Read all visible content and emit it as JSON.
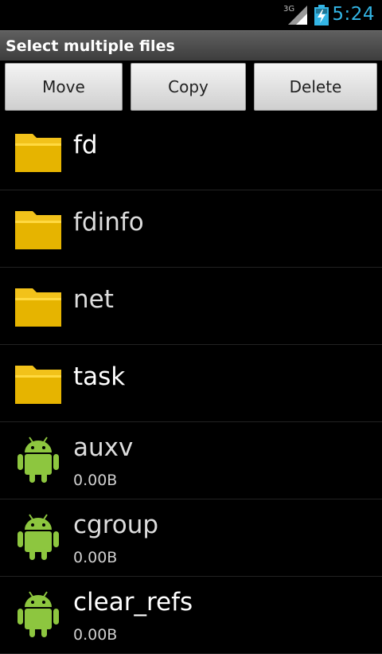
{
  "status": {
    "network": "3G",
    "time": "5:24"
  },
  "title": "Select multiple files",
  "toolbar": {
    "move": "Move",
    "copy": "Copy",
    "delete": "Delete"
  },
  "items": [
    {
      "name": "fd",
      "type": "folder"
    },
    {
      "name": "fdinfo",
      "type": "folder"
    },
    {
      "name": "net",
      "type": "folder"
    },
    {
      "name": "task",
      "type": "folder"
    },
    {
      "name": "auxv",
      "type": "file",
      "size": "0.00B"
    },
    {
      "name": "cgroup",
      "type": "file",
      "size": "0.00B"
    },
    {
      "name": "clear_refs",
      "type": "file",
      "size": "0.00B"
    }
  ],
  "colors": {
    "accent": "#33b5e5",
    "folder": "#e5b400",
    "android": "#8dc63f"
  }
}
